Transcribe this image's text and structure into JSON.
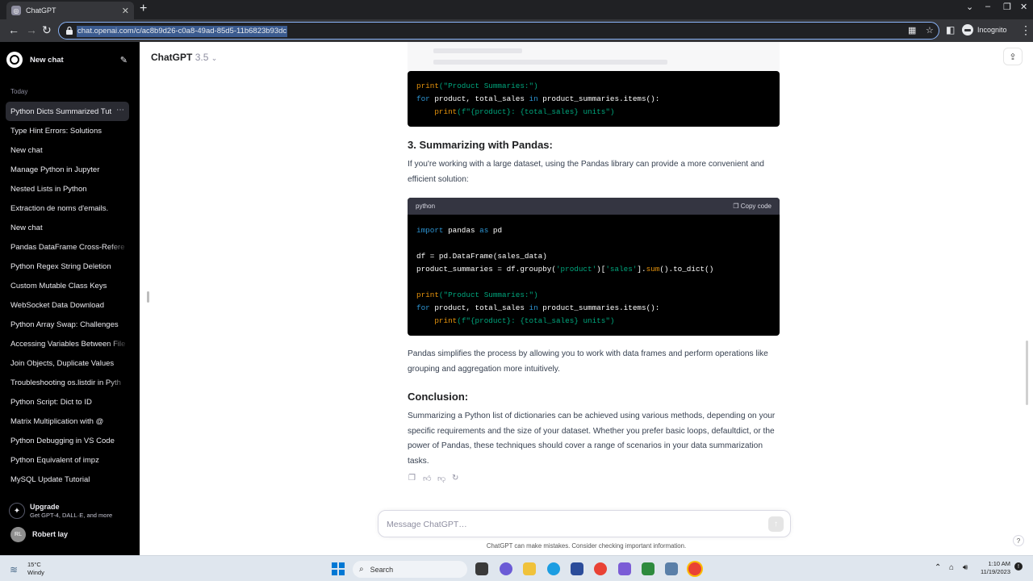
{
  "browser": {
    "tab_title": "ChatGPT",
    "url": "chat.openai.com/c/ac8b9d26-c0a8-49ad-85d5-11b6823b93dc",
    "incognito_label": "Incognito"
  },
  "sidebar": {
    "new_chat_label": "New chat",
    "section_today": "Today",
    "chats": [
      "Python Dicts Summarized Tut",
      "Type Hint Errors: Solutions",
      "New chat",
      "Manage Python in Jupyter",
      "Nested Lists in Python",
      "Extraction de noms d'emails.",
      "New chat",
      "Pandas DataFrame Cross-Refere",
      "Python Regex String Deletion",
      "Custom Mutable Class Keys",
      "WebSocket Data Download",
      "Python Array Swap: Challenges",
      "Accessing Variables Between File",
      "Join Objects, Duplicate Values",
      "Troubleshooting os.listdir in Pyth",
      "Python Script: Dict to ID",
      "Matrix Multiplication with @",
      "Python Debugging in VS Code",
      "Python Equivalent of impz",
      "MySQL Update Tutorial"
    ],
    "upgrade_title": "Upgrade",
    "upgrade_subtitle": "Get GPT-4, DALL·E, and more",
    "user_initials": "RL",
    "user_name": "Robert lay"
  },
  "header": {
    "model_name": "ChatGPT",
    "model_version": "3.5"
  },
  "content": {
    "code1_lines": {
      "print": "print",
      "l1_str": "(\"Product Summaries:\")",
      "for": "for",
      "l2_mid": " product, total_sales ",
      "in": "in",
      "l2_end": " product_summaries.items():",
      "l3_str": "(f\"{product}: {total_sales} units\")"
    },
    "heading3": "3. Summarizing with Pandas:",
    "pandas_intro": "If you're working with a large dataset, using the Pandas library can provide a more convenient and efficient solution:",
    "code2": {
      "language": "python",
      "copy_label": "Copy code",
      "import": "import",
      "pandas": " pandas ",
      "as": "as",
      "pd": " pd",
      "df_line": "df = pd.DataFrame(sales_data)",
      "ps_start": "product_summaries = df.groupby(",
      "ps_product": "'product'",
      "ps_mid": ")[",
      "ps_sales": "'sales'",
      "ps_mid2": "].",
      "ps_sum": "sum",
      "ps_end": "().to_dict()"
    },
    "pandas_outro": "Pandas simplifies the process by allowing you to work with data frames and perform operations like grouping and aggregation more intuitively.",
    "conclusion_heading": "Conclusion:",
    "conclusion_text": "Summarizing a Python list of dictionaries can be achieved using various methods, depending on your specific requirements and the size of your dataset. Whether you prefer basic loops, defaultdict, or the power of Pandas, these techniques should cover a range of scenarios in your data summarization tasks."
  },
  "composer": {
    "placeholder": "Message ChatGPT…",
    "disclaimer": "ChatGPT can make mistakes. Consider checking important information."
  },
  "taskbar": {
    "temperature": "15°C",
    "weather": "Windy",
    "search_label": "Search",
    "time": "1:10 AM",
    "date": "11/19/2023"
  },
  "colors": {
    "sidebar_bg": "#000000",
    "code_bg": "#000000",
    "keyword": "#2e95d3",
    "string": "#00a67d",
    "function": "#e9950c",
    "omnibox_border": "#8ab4f8"
  }
}
